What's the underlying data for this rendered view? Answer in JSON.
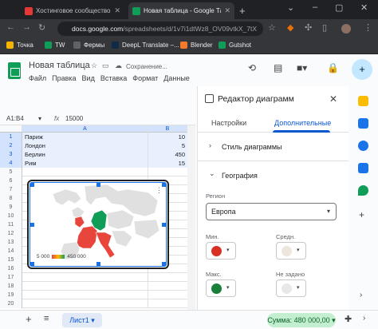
{
  "browser": {
    "tabs": [
      {
        "title": "Хостинговое сообщество «Ти",
        "favicon_color": "#e53935"
      },
      {
        "title": "Новая таблица - Google Табл",
        "favicon_color": "#0f9d58"
      }
    ],
    "url_host": "docs.google.com",
    "url_path": "/spreadsheets/d/1v7i1dtWz8_OV09vtkX_7tX",
    "bookmarks": [
      {
        "label": "Точка",
        "color": "#f4b400"
      },
      {
        "label": "TW",
        "color": "#0f9d58"
      },
      {
        "label": "Фермы",
        "color": "#5f6368"
      },
      {
        "label": "DeepL Translate –...",
        "color": "#0f2b46"
      },
      {
        "label": "Blender",
        "color": "#f5792a"
      },
      {
        "label": "Gutshot",
        "color": "#0f9d58"
      }
    ]
  },
  "doc": {
    "title": "Новая таблица",
    "saving": "Сохранение...",
    "menus": [
      "Файл",
      "Правка",
      "Вид",
      "Вставка",
      "Формат",
      "Данные"
    ],
    "avatar_icon": "add-person-icon"
  },
  "formula_bar": {
    "range": "A1:B4",
    "fx": "fx",
    "value": "15000"
  },
  "sheet": {
    "col_headers": [
      "A",
      "B"
    ],
    "rows": [
      {
        "n": "1",
        "a": "Париж",
        "b": "10"
      },
      {
        "n": "2",
        "a": "Лондон",
        "b": "5"
      },
      {
        "n": "3",
        "a": "Берлин",
        "b": "450"
      },
      {
        "n": "4",
        "a": "Рим",
        "b": "15"
      },
      {
        "n": "5",
        "a": "",
        "b": ""
      },
      {
        "n": "6",
        "a": "",
        "b": ""
      },
      {
        "n": "7",
        "a": "",
        "b": ""
      },
      {
        "n": "8",
        "a": "",
        "b": ""
      },
      {
        "n": "9",
        "a": "",
        "b": ""
      },
      {
        "n": "10",
        "a": "",
        "b": ""
      },
      {
        "n": "11",
        "a": "",
        "b": ""
      },
      {
        "n": "12",
        "a": "",
        "b": ""
      },
      {
        "n": "13",
        "a": "",
        "b": ""
      },
      {
        "n": "14",
        "a": "",
        "b": ""
      },
      {
        "n": "15",
        "a": "",
        "b": ""
      },
      {
        "n": "16",
        "a": "",
        "b": ""
      },
      {
        "n": "17",
        "a": "",
        "b": ""
      },
      {
        "n": "18",
        "a": "",
        "b": ""
      },
      {
        "n": "19",
        "a": "",
        "b": ""
      },
      {
        "n": "20",
        "a": "",
        "b": ""
      }
    ],
    "tab_name": "Лист1",
    "sum": "Сумма: 480 000,00"
  },
  "chart": {
    "type": "geo",
    "legend_min": "5 000",
    "legend_max": "450 000",
    "colors": {
      "min": "#e8453c",
      "max": "#0f9d58",
      "land": "#e0e0e0"
    }
  },
  "panel": {
    "title": "Редактор диаграмм",
    "tab_setup": "Настройки",
    "tab_custom": "Дополнительные",
    "section_style": "Стиль диаграммы",
    "section_geo": "География",
    "region_label": "Регион",
    "region_value": "Европа",
    "min_label": "Мин.",
    "mid_label": "Средн.",
    "max_label": "Макс.",
    "nodata_label": "Не задано",
    "colors": {
      "min": "#d93025",
      "mid": "#ede6dd",
      "max": "#188038",
      "nodata": "#e8e8e8"
    }
  }
}
